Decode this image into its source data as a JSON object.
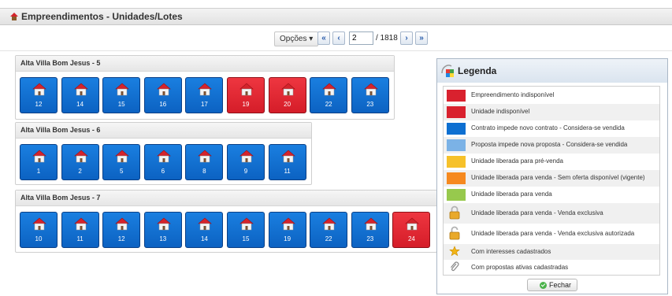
{
  "header": {
    "title": "Empreendimentos - Unidades/Lotes"
  },
  "toolbar": {
    "options_label": "Opções",
    "first_label": "«",
    "prev_label": "‹",
    "page_value": "2",
    "total": "/ 1818",
    "next_label": "›",
    "last_label": "»"
  },
  "groups": [
    {
      "name": "Alta Villa Bom Jesus - 5",
      "units": [
        {
          "n": "12",
          "status": "contrato"
        },
        {
          "n": "14",
          "status": "contrato"
        },
        {
          "n": "15",
          "status": "contrato"
        },
        {
          "n": "16",
          "status": "contrato"
        },
        {
          "n": "17",
          "status": "contrato"
        },
        {
          "n": "19",
          "status": "indisponivel"
        },
        {
          "n": "20",
          "status": "indisponivel"
        },
        {
          "n": "22",
          "status": "contrato"
        },
        {
          "n": "23",
          "status": "contrato"
        }
      ]
    },
    {
      "name": "Alta Villa Bom Jesus - 6",
      "units": [
        {
          "n": "1",
          "status": "contrato"
        },
        {
          "n": "2",
          "status": "contrato"
        },
        {
          "n": "5",
          "status": "contrato"
        },
        {
          "n": "6",
          "status": "contrato"
        },
        {
          "n": "8",
          "status": "contrato"
        },
        {
          "n": "9",
          "status": "contrato"
        },
        {
          "n": "11",
          "status": "contrato"
        }
      ]
    },
    {
      "name": "Alta Villa Bom Jesus - 7",
      "units": [
        {
          "n": "10",
          "status": "contrato"
        },
        {
          "n": "11",
          "status": "contrato"
        },
        {
          "n": "12",
          "status": "contrato"
        },
        {
          "n": "13",
          "status": "contrato"
        },
        {
          "n": "14",
          "status": "contrato"
        },
        {
          "n": "15",
          "status": "contrato"
        },
        {
          "n": "19",
          "status": "contrato"
        },
        {
          "n": "22",
          "status": "contrato"
        },
        {
          "n": "23",
          "status": "contrato"
        },
        {
          "n": "24",
          "status": "indisponivel"
        }
      ]
    }
  ],
  "legend": {
    "title": "Legenda",
    "close_label": "Fechar",
    "items": [
      {
        "label": "Empreendimento indisponível",
        "color": "#d9212e",
        "icon": "swatch"
      },
      {
        "label": "Unidade indisponível",
        "color": "#d9212e",
        "icon": "swatch"
      },
      {
        "label": "Contrato impede novo contrato - Considera-se vendida",
        "color": "#0d6fd1",
        "icon": "swatch"
      },
      {
        "label": "Proposta impede nova proposta - Considera-se vendida",
        "color": "#7bb2e6",
        "icon": "swatch"
      },
      {
        "label": "Unidade liberada para pré-venda",
        "color": "#f6c12a",
        "icon": "swatch"
      },
      {
        "label": "Unidade liberada para venda - Sem oferta disponível (vigente)",
        "color": "#f6891f",
        "icon": "swatch"
      },
      {
        "label": "Unidade liberada para venda",
        "color": "#97c94d",
        "icon": "swatch"
      },
      {
        "label": "Unidade liberada para venda - Venda exclusiva",
        "color": "#e0a32a",
        "icon": "lock-icon"
      },
      {
        "label": "Unidade liberada para venda - Venda exclusiva autorizada",
        "color": "#e0a32a",
        "icon": "unlock-icon"
      },
      {
        "label": "Com interesses cadastrados",
        "color": "#f2b416",
        "icon": "star-icon"
      },
      {
        "label": "Com propostas ativas cadastradas",
        "color": "#888888",
        "icon": "paperclip-icon"
      }
    ]
  }
}
